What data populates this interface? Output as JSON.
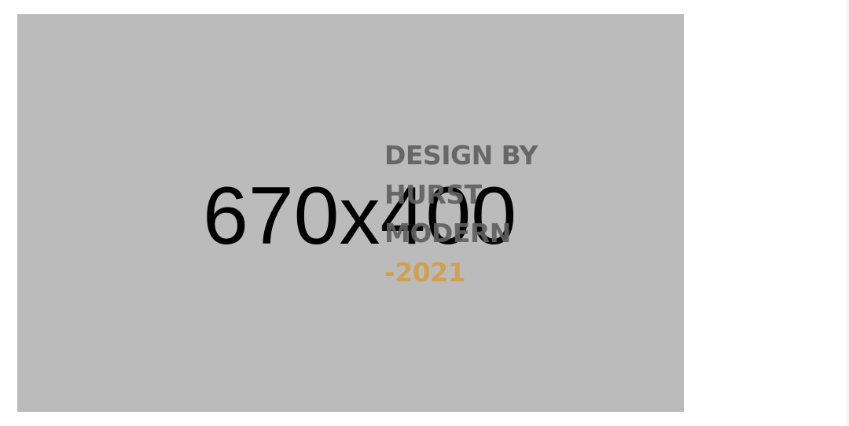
{
  "hero": {
    "placeholder_label": "670x400",
    "headline": [
      "DESIGN BY",
      "HURST",
      "MODERN"
    ],
    "year": "-2021",
    "colors": {
      "placeholder_bg": "#bbbbbb",
      "headline": "#606060",
      "year_accent": "#d1a050"
    }
  }
}
